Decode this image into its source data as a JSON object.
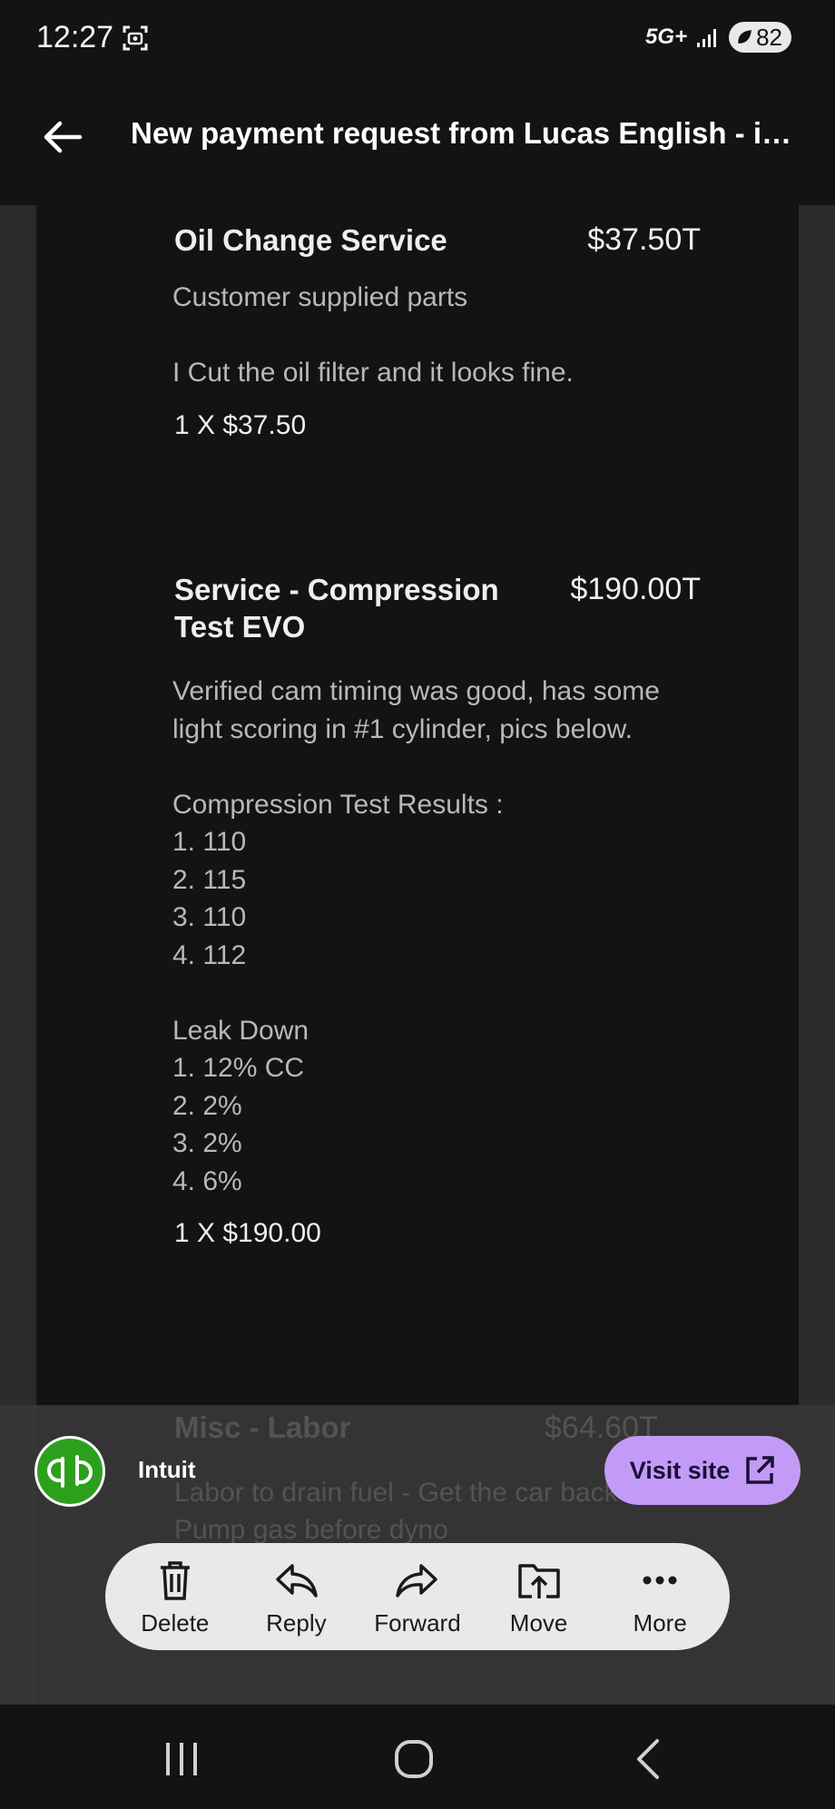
{
  "status_bar": {
    "time": "12:27",
    "network": "5G+",
    "battery": "82"
  },
  "header": {
    "title": "New payment request from Lucas English - in..."
  },
  "line_items": [
    {
      "name": "Oil Change Service",
      "price": "$37.50T",
      "description": "Customer supplied parts\n\nI Cut the oil filter and it looks fine.",
      "quantity": "1 X $37.50"
    },
    {
      "name": "Service - Compression Test EVO",
      "price": "$190.00T",
      "description": "Verified cam timing was good, has some light scoring in #1 cylinder, pics below.\n\nCompression Test Results :\n1. 110\n2. 115\n3. 110\n4. 112\n\nLeak Down\n1. 12% CC\n2. 2%\n3. 2%\n4. 6%",
      "quantity": "1 X $190.00"
    },
    {
      "name": "Misc - Labor",
      "price": "$64.60T",
      "description": "Labor to drain fuel - Get the car back\nPump gas before dyno"
    }
  ],
  "ad": {
    "brand": "Intuit",
    "button_label": "Visit site"
  },
  "actions": {
    "delete": "Delete",
    "reply": "Reply",
    "forward": "Forward",
    "move": "Move",
    "more": "More"
  },
  "colors": {
    "background": "#131313",
    "card": "#131313",
    "accent_button": "#c39bf7",
    "brand_green": "#2ca01c"
  },
  "icons": [
    "screenshot-icon",
    "back-arrow-icon",
    "trash-icon",
    "reply-icon",
    "forward-icon",
    "move-icon",
    "more-icon",
    "external-link-icon",
    "recents-icon",
    "home-icon",
    "back-nav-icon"
  ]
}
